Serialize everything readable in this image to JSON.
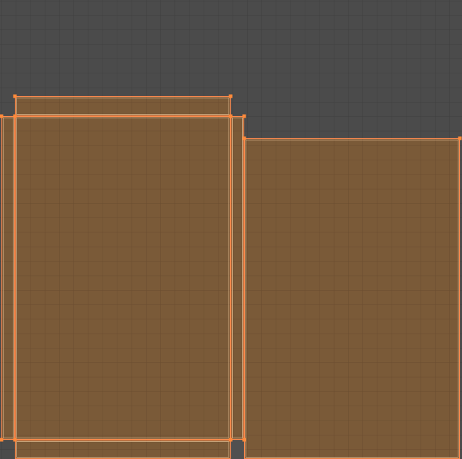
{
  "editor": {
    "view": "uv-editor-viewport",
    "grid_visible": true
  },
  "colors": {
    "background": "#4a4a4a",
    "grid_line": "#404040",
    "grid_line_major": "#3b3b3b",
    "face_fill": "#7a5a38",
    "face_fill_opacity": 1,
    "face_grid_line": "#6b4d2e",
    "edge": "#ff8a4c",
    "edge_inner": "#d9b48a",
    "vertex": "#ff8a3a",
    "dark_gap": "#505050"
  },
  "uv_islands": [
    {
      "name": "uv-island-top-strip"
    },
    {
      "name": "uv-island-left-edge-strip"
    },
    {
      "name": "uv-island-left-main"
    },
    {
      "name": "uv-island-middle-strip"
    },
    {
      "name": "uv-island-bottom-strip"
    },
    {
      "name": "uv-island-right-main"
    }
  ]
}
